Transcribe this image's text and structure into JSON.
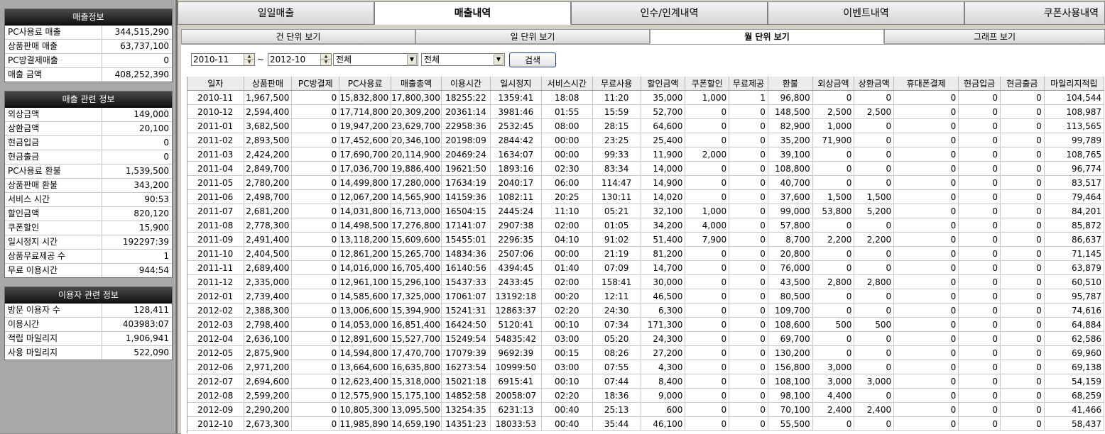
{
  "left": {
    "sales_info": {
      "title": "매출정보",
      "rows": [
        {
          "label": "PC사용료 매출",
          "value": "344,515,290"
        },
        {
          "label": "상품판매 매출",
          "value": "63,737,100"
        },
        {
          "label": "PC방결제매출",
          "value": "0"
        },
        {
          "label": "매출 금액",
          "value": "408,252,390"
        }
      ]
    },
    "sales_related": {
      "title": "매출 관련 정보",
      "rows": [
        {
          "label": "외상금액",
          "value": "149,000"
        },
        {
          "label": "상환금액",
          "value": "20,100"
        },
        {
          "label": "현금입금",
          "value": "0"
        },
        {
          "label": "현금출금",
          "value": "0"
        },
        {
          "label": "PC사용료 환불",
          "value": "1,539,500"
        },
        {
          "label": "상품판매 환불",
          "value": "343,200"
        },
        {
          "label": "서비스 시간",
          "value": "90:53"
        },
        {
          "label": "할인금액",
          "value": "820,120"
        },
        {
          "label": "쿠폰할인",
          "value": "15,900"
        },
        {
          "label": "일시정지 시간",
          "value": "192297:39"
        },
        {
          "label": "상품무료제공 수",
          "value": "1"
        },
        {
          "label": "무료 이용시간",
          "value": "944:54"
        }
      ]
    },
    "user_related": {
      "title": "이용자 관련 정보",
      "rows": [
        {
          "label": "방문 이용자 수",
          "value": "128,411"
        },
        {
          "label": "이용시간",
          "value": "403983:07"
        },
        {
          "label": "적립 마일리지",
          "value": "1,906,941"
        },
        {
          "label": "사용 마일리지",
          "value": "522,090"
        }
      ]
    }
  },
  "top_tabs": [
    "일일매출",
    "매출내역",
    "인수/인계내역",
    "이벤트내역",
    "쿠폰사용내역"
  ],
  "sub_tabs": [
    "건 단위 보기",
    "일 단위 보기",
    "월 단위 보기",
    "그래프 보기"
  ],
  "toolbar": {
    "from": "2010-11",
    "tilde": "~",
    "to": "2012-10",
    "filter1": "전체",
    "filter2": "전체",
    "search_label": "검색"
  },
  "table": {
    "columns": [
      "일자",
      "상품판매",
      "PC방결제",
      "PC사용료",
      "매출총액",
      "이용시간",
      "일시정지",
      "서비스시간",
      "무료사용",
      "할인금액",
      "쿠폰할인",
      "무료제공",
      "환불",
      "외상금액",
      "상환금액",
      "휴대폰결제",
      "현금입금",
      "현금출금",
      "마일리지적립"
    ],
    "rows": [
      [
        "2010-11",
        "1,967,500",
        "0",
        "15,832,800",
        "17,800,300",
        "18255:22",
        "1359:41",
        "18:08",
        "11:20",
        "35,000",
        "1,000",
        "1",
        "96,800",
        "0",
        "0",
        "0",
        "0",
        "0",
        "104,544"
      ],
      [
        "2010-12",
        "2,594,400",
        "0",
        "17,714,800",
        "20,309,200",
        "20361:14",
        "3981:46",
        "01:55",
        "15:59",
        "52,700",
        "0",
        "0",
        "148,500",
        "2,500",
        "2,500",
        "0",
        "0",
        "0",
        "108,987"
      ],
      [
        "2011-01",
        "3,682,500",
        "0",
        "19,947,200",
        "23,629,700",
        "22958:36",
        "2532:45",
        "08:00",
        "28:15",
        "64,600",
        "0",
        "0",
        "82,900",
        "1,000",
        "0",
        "0",
        "0",
        "0",
        "113,565"
      ],
      [
        "2011-02",
        "2,893,500",
        "0",
        "17,452,600",
        "20,346,100",
        "20198:09",
        "2844:42",
        "00:00",
        "23:25",
        "25,400",
        "0",
        "0",
        "35,200",
        "71,900",
        "0",
        "0",
        "0",
        "0",
        "99,789"
      ],
      [
        "2011-03",
        "2,424,200",
        "0",
        "17,690,700",
        "20,114,900",
        "20469:24",
        "1634:07",
        "00:00",
        "99:33",
        "11,900",
        "2,000",
        "0",
        "39,100",
        "0",
        "0",
        "0",
        "0",
        "0",
        "108,765"
      ],
      [
        "2011-04",
        "2,849,700",
        "0",
        "17,036,700",
        "19,886,400",
        "19621:50",
        "1893:16",
        "02:30",
        "83:34",
        "14,000",
        "0",
        "0",
        "108,800",
        "0",
        "0",
        "0",
        "0",
        "0",
        "96,774"
      ],
      [
        "2011-05",
        "2,780,200",
        "0",
        "14,499,800",
        "17,280,000",
        "17634:19",
        "2040:17",
        "06:00",
        "114:47",
        "14,900",
        "0",
        "0",
        "40,700",
        "0",
        "0",
        "0",
        "0",
        "0",
        "83,517"
      ],
      [
        "2011-06",
        "2,498,700",
        "0",
        "12,067,200",
        "14,565,900",
        "14159:36",
        "1082:11",
        "20:25",
        "130:11",
        "14,020",
        "0",
        "0",
        "37,600",
        "1,500",
        "1,500",
        "0",
        "0",
        "0",
        "79,464"
      ],
      [
        "2011-07",
        "2,681,200",
        "0",
        "14,031,800",
        "16,713,000",
        "16504:15",
        "2445:24",
        "11:10",
        "05:21",
        "32,100",
        "1,000",
        "0",
        "99,000",
        "53,800",
        "5,200",
        "0",
        "0",
        "0",
        "84,201"
      ],
      [
        "2011-08",
        "2,778,300",
        "0",
        "14,498,500",
        "17,276,800",
        "17141:07",
        "2907:38",
        "02:00",
        "01:05",
        "34,200",
        "4,000",
        "0",
        "57,800",
        "0",
        "0",
        "0",
        "0",
        "0",
        "85,872"
      ],
      [
        "2011-09",
        "2,491,400",
        "0",
        "13,118,200",
        "15,609,600",
        "15455:01",
        "2296:35",
        "04:10",
        "91:02",
        "51,400",
        "7,900",
        "0",
        "8,700",
        "2,200",
        "2,200",
        "0",
        "0",
        "0",
        "86,637"
      ],
      [
        "2011-10",
        "2,404,500",
        "0",
        "12,861,200",
        "15,265,700",
        "14834:36",
        "2507:06",
        "00:00",
        "21:19",
        "81,200",
        "0",
        "0",
        "20,800",
        "0",
        "0",
        "0",
        "0",
        "0",
        "71,145"
      ],
      [
        "2011-11",
        "2,689,400",
        "0",
        "14,016,000",
        "16,705,400",
        "16140:56",
        "4394:45",
        "01:40",
        "07:09",
        "14,700",
        "0",
        "0",
        "76,000",
        "0",
        "0",
        "0",
        "0",
        "0",
        "63,879"
      ],
      [
        "2011-12",
        "2,335,000",
        "0",
        "12,961,100",
        "15,296,100",
        "15437:33",
        "2433:45",
        "02:00",
        "158:41",
        "30,000",
        "0",
        "0",
        "43,500",
        "2,800",
        "2,800",
        "0",
        "0",
        "0",
        "60,510"
      ],
      [
        "2012-01",
        "2,739,400",
        "0",
        "14,585,600",
        "17,325,000",
        "17061:07",
        "13192:18",
        "00:20",
        "12:11",
        "46,500",
        "0",
        "0",
        "80,500",
        "0",
        "0",
        "0",
        "0",
        "0",
        "95,787"
      ],
      [
        "2012-02",
        "2,388,300",
        "0",
        "13,006,600",
        "15,394,900",
        "15241:31",
        "12863:37",
        "02:20",
        "24:30",
        "6,300",
        "0",
        "0",
        "109,700",
        "0",
        "0",
        "0",
        "0",
        "0",
        "74,616"
      ],
      [
        "2012-03",
        "2,798,400",
        "0",
        "14,053,000",
        "16,851,400",
        "16424:50",
        "5120:41",
        "00:10",
        "07:34",
        "171,300",
        "0",
        "0",
        "108,600",
        "500",
        "500",
        "0",
        "0",
        "0",
        "64,884"
      ],
      [
        "2012-04",
        "2,636,100",
        "0",
        "12,891,600",
        "15,527,700",
        "15249:54",
        "54835:42",
        "03:00",
        "05:20",
        "24,300",
        "0",
        "0",
        "69,700",
        "0",
        "0",
        "0",
        "0",
        "0",
        "62,586"
      ],
      [
        "2012-05",
        "2,875,900",
        "0",
        "14,594,800",
        "17,470,700",
        "17079:39",
        "9692:39",
        "00:15",
        "08:26",
        "27,200",
        "0",
        "0",
        "130,200",
        "0",
        "0",
        "0",
        "0",
        "0",
        "69,960"
      ],
      [
        "2012-06",
        "2,971,200",
        "0",
        "13,664,600",
        "16,635,800",
        "16273:54",
        "10999:50",
        "03:00",
        "07:55",
        "4,300",
        "0",
        "0",
        "156,800",
        "3,000",
        "0",
        "0",
        "0",
        "0",
        "69,138"
      ],
      [
        "2012-07",
        "2,694,600",
        "0",
        "12,623,400",
        "15,318,000",
        "15021:18",
        "6915:41",
        "00:10",
        "07:44",
        "8,400",
        "0",
        "0",
        "108,100",
        "3,000",
        "3,000",
        "0",
        "0",
        "0",
        "54,159"
      ],
      [
        "2012-08",
        "2,599,200",
        "0",
        "12,575,900",
        "15,175,100",
        "14852:58",
        "20058:07",
        "02:20",
        "18:36",
        "9,000",
        "0",
        "0",
        "98,100",
        "4,400",
        "0",
        "0",
        "0",
        "0",
        "68,259"
      ],
      [
        "2012-09",
        "2,290,200",
        "0",
        "10,805,300",
        "13,095,500",
        "13254:35",
        "6231:13",
        "00:40",
        "25:13",
        "600",
        "0",
        "0",
        "70,100",
        "2,400",
        "2,400",
        "0",
        "0",
        "0",
        "41,466"
      ],
      [
        "2012-10",
        "2,673,300",
        "0",
        "11,985,890",
        "14,659,190",
        "14351:23",
        "18033:53",
        "00:40",
        "35:44",
        "46,100",
        "0",
        "0",
        "55,500",
        "0",
        "0",
        "0",
        "0",
        "0",
        "58,437"
      ]
    ]
  }
}
